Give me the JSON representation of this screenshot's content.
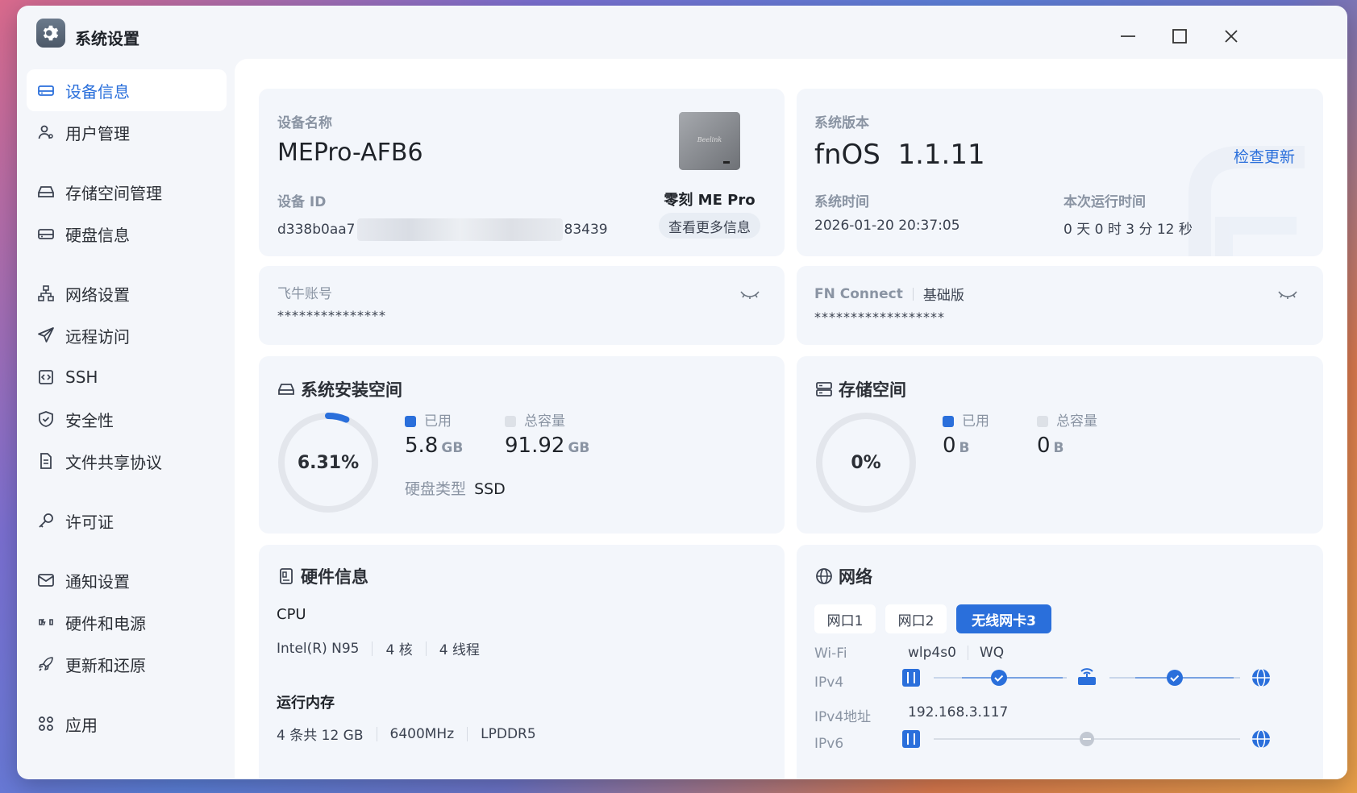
{
  "window": {
    "title": "系统设置"
  },
  "sidebar": {
    "items": [
      {
        "label": "设备信息",
        "icon": "device-info-icon",
        "active": true
      },
      {
        "label": "用户管理",
        "icon": "user-icon"
      },
      {
        "label": "存储空间管理",
        "icon": "storage-icon"
      },
      {
        "label": "硬盘信息",
        "icon": "disk-icon"
      },
      {
        "label": "网络设置",
        "icon": "network-icon"
      },
      {
        "label": "远程访问",
        "icon": "send-icon"
      },
      {
        "label": "SSH",
        "icon": "ssh-icon"
      },
      {
        "label": "安全性",
        "icon": "shield-icon"
      },
      {
        "label": "文件共享协议",
        "icon": "file-icon"
      },
      {
        "label": "许可证",
        "icon": "key-icon"
      },
      {
        "label": "通知设置",
        "icon": "mail-icon"
      },
      {
        "label": "硬件和电源",
        "icon": "power-icon"
      },
      {
        "label": "更新和还原",
        "icon": "rocket-icon"
      },
      {
        "label": "应用",
        "icon": "apps-icon"
      }
    ]
  },
  "device": {
    "name_label": "设备名称",
    "name": "MEPro-AFB6",
    "id_label": "设备 ID",
    "id_prefix": "d338b0aa7",
    "id_suffix": "83439",
    "product_name": "零刻 ME Pro",
    "more_info_button": "查看更多信息"
  },
  "system": {
    "version_label": "系统版本",
    "version": "fnOS  1.1.11",
    "check_update": "检查更新",
    "time_label": "系统时间",
    "time": "2026-01-20 20:37:05",
    "uptime_label": "本次运行时间",
    "uptime": "0 天 0 时 3 分 12 秒"
  },
  "account": {
    "label": "飞牛账号",
    "value": "***************"
  },
  "fn_connect": {
    "label": "FN Connect",
    "tier": "基础版",
    "value": "******************"
  },
  "system_space": {
    "title": "系统安装空间",
    "percent_text": "6.31%",
    "percent": 0.0631,
    "used_label": "已用",
    "used_value": "5.8",
    "used_unit": "GB",
    "total_label": "总容量",
    "total_value": "91.92",
    "total_unit": "GB",
    "disk_type_label": "硬盘类型",
    "disk_type": "SSD"
  },
  "storage_space": {
    "title": "存储空间",
    "percent_text": "0%",
    "used_label": "已用",
    "used_value": "0",
    "used_unit": "B",
    "total_label": "总容量",
    "total_value": "0",
    "total_unit": "B"
  },
  "hardware": {
    "title": "硬件信息",
    "cpu_label": "CPU",
    "cpu_model": "Intel(R) N95",
    "cpu_cores": "4 核",
    "cpu_threads": "4 线程",
    "mem_label": "运行内存",
    "mem_total": "4 条共 12 GB",
    "mem_freq": "6400MHz",
    "mem_type": "LPDDR5"
  },
  "network": {
    "title": "网络",
    "tabs": [
      "网口1",
      "网口2",
      "无线网卡3"
    ],
    "active_tab": 2,
    "wifi_label": "Wi-Fi",
    "wifi_iface": "wlp4s0",
    "wifi_ssid": "WQ",
    "ipv4_label": "IPv4",
    "ipv4_addr_label": "IPv4地址",
    "ipv4_addr": "192.168.3.117",
    "ipv6_label": "IPv6"
  },
  "colors": {
    "accent": "#2a6fdb",
    "ring_bg": "#e3e6ec",
    "card_bg": "#f3f6fb"
  }
}
